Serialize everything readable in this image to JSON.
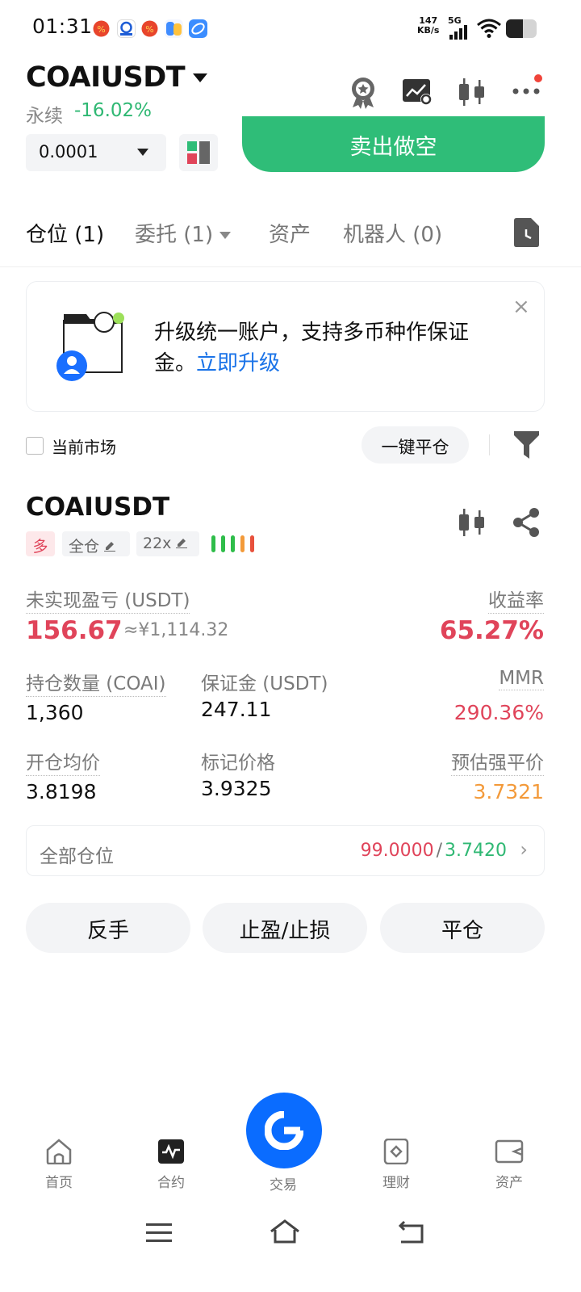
{
  "status_bar": {
    "time": "01:31",
    "speed_value": "147",
    "speed_unit": "KB/s",
    "network": "5G"
  },
  "header": {
    "pair": "COAIUSDT",
    "contract_type": "永续",
    "change_pct": "-16.02%",
    "quantity_value": "0.0001",
    "sell_button": "卖出做空"
  },
  "tabs": [
    {
      "label": "仓位 (1)"
    },
    {
      "label": "委托 (1)"
    },
    {
      "label": "资产"
    },
    {
      "label": "机器人 (0)"
    }
  ],
  "banner": {
    "text": "升级统一账户，支持多币种作保证金。",
    "link": "立即升级",
    "close": "×"
  },
  "filters": {
    "current_market": "当前市场",
    "close_all": "一键平仓"
  },
  "position": {
    "symbol": "COAIUSDT",
    "side": "多",
    "margin_mode": "全仓",
    "leverage": "22x",
    "unrealized_pnl_label": "未实现盈亏 (USDT)",
    "unrealized_pnl": "156.67",
    "unrealized_pnl_cny": "≈¥1,114.32",
    "roe_label": "收益率",
    "roe": "65.27%",
    "size_label": "持仓数量 (COAI)",
    "size": "1,360",
    "margin_label": "保证金 (USDT)",
    "margin": "247.11",
    "mmr_label": "MMR",
    "mmr": "290.36%",
    "entry_label": "开仓均价",
    "entry": "3.8198",
    "mark_label": "标记价格",
    "mark": "3.9325",
    "liq_label": "预估强平价",
    "liq": "3.7321",
    "all_positions_label": "全部仓位",
    "tp": "99.0000",
    "slash": "/",
    "sl": "3.7420",
    "chevron": "›",
    "btn_reverse": "反手",
    "btn_tpsl": "止盈/止损",
    "btn_close": "平仓"
  },
  "bottom_nav": [
    {
      "label": "首页"
    },
    {
      "label": "合约"
    },
    {
      "label": "交易"
    },
    {
      "label": "理财"
    },
    {
      "label": "资产"
    }
  ],
  "colors": {
    "green": "#2fb873",
    "red": "#e0445a",
    "orange": "#f39a3a",
    "blue": "#0a6cff",
    "link": "#1a73e8"
  }
}
